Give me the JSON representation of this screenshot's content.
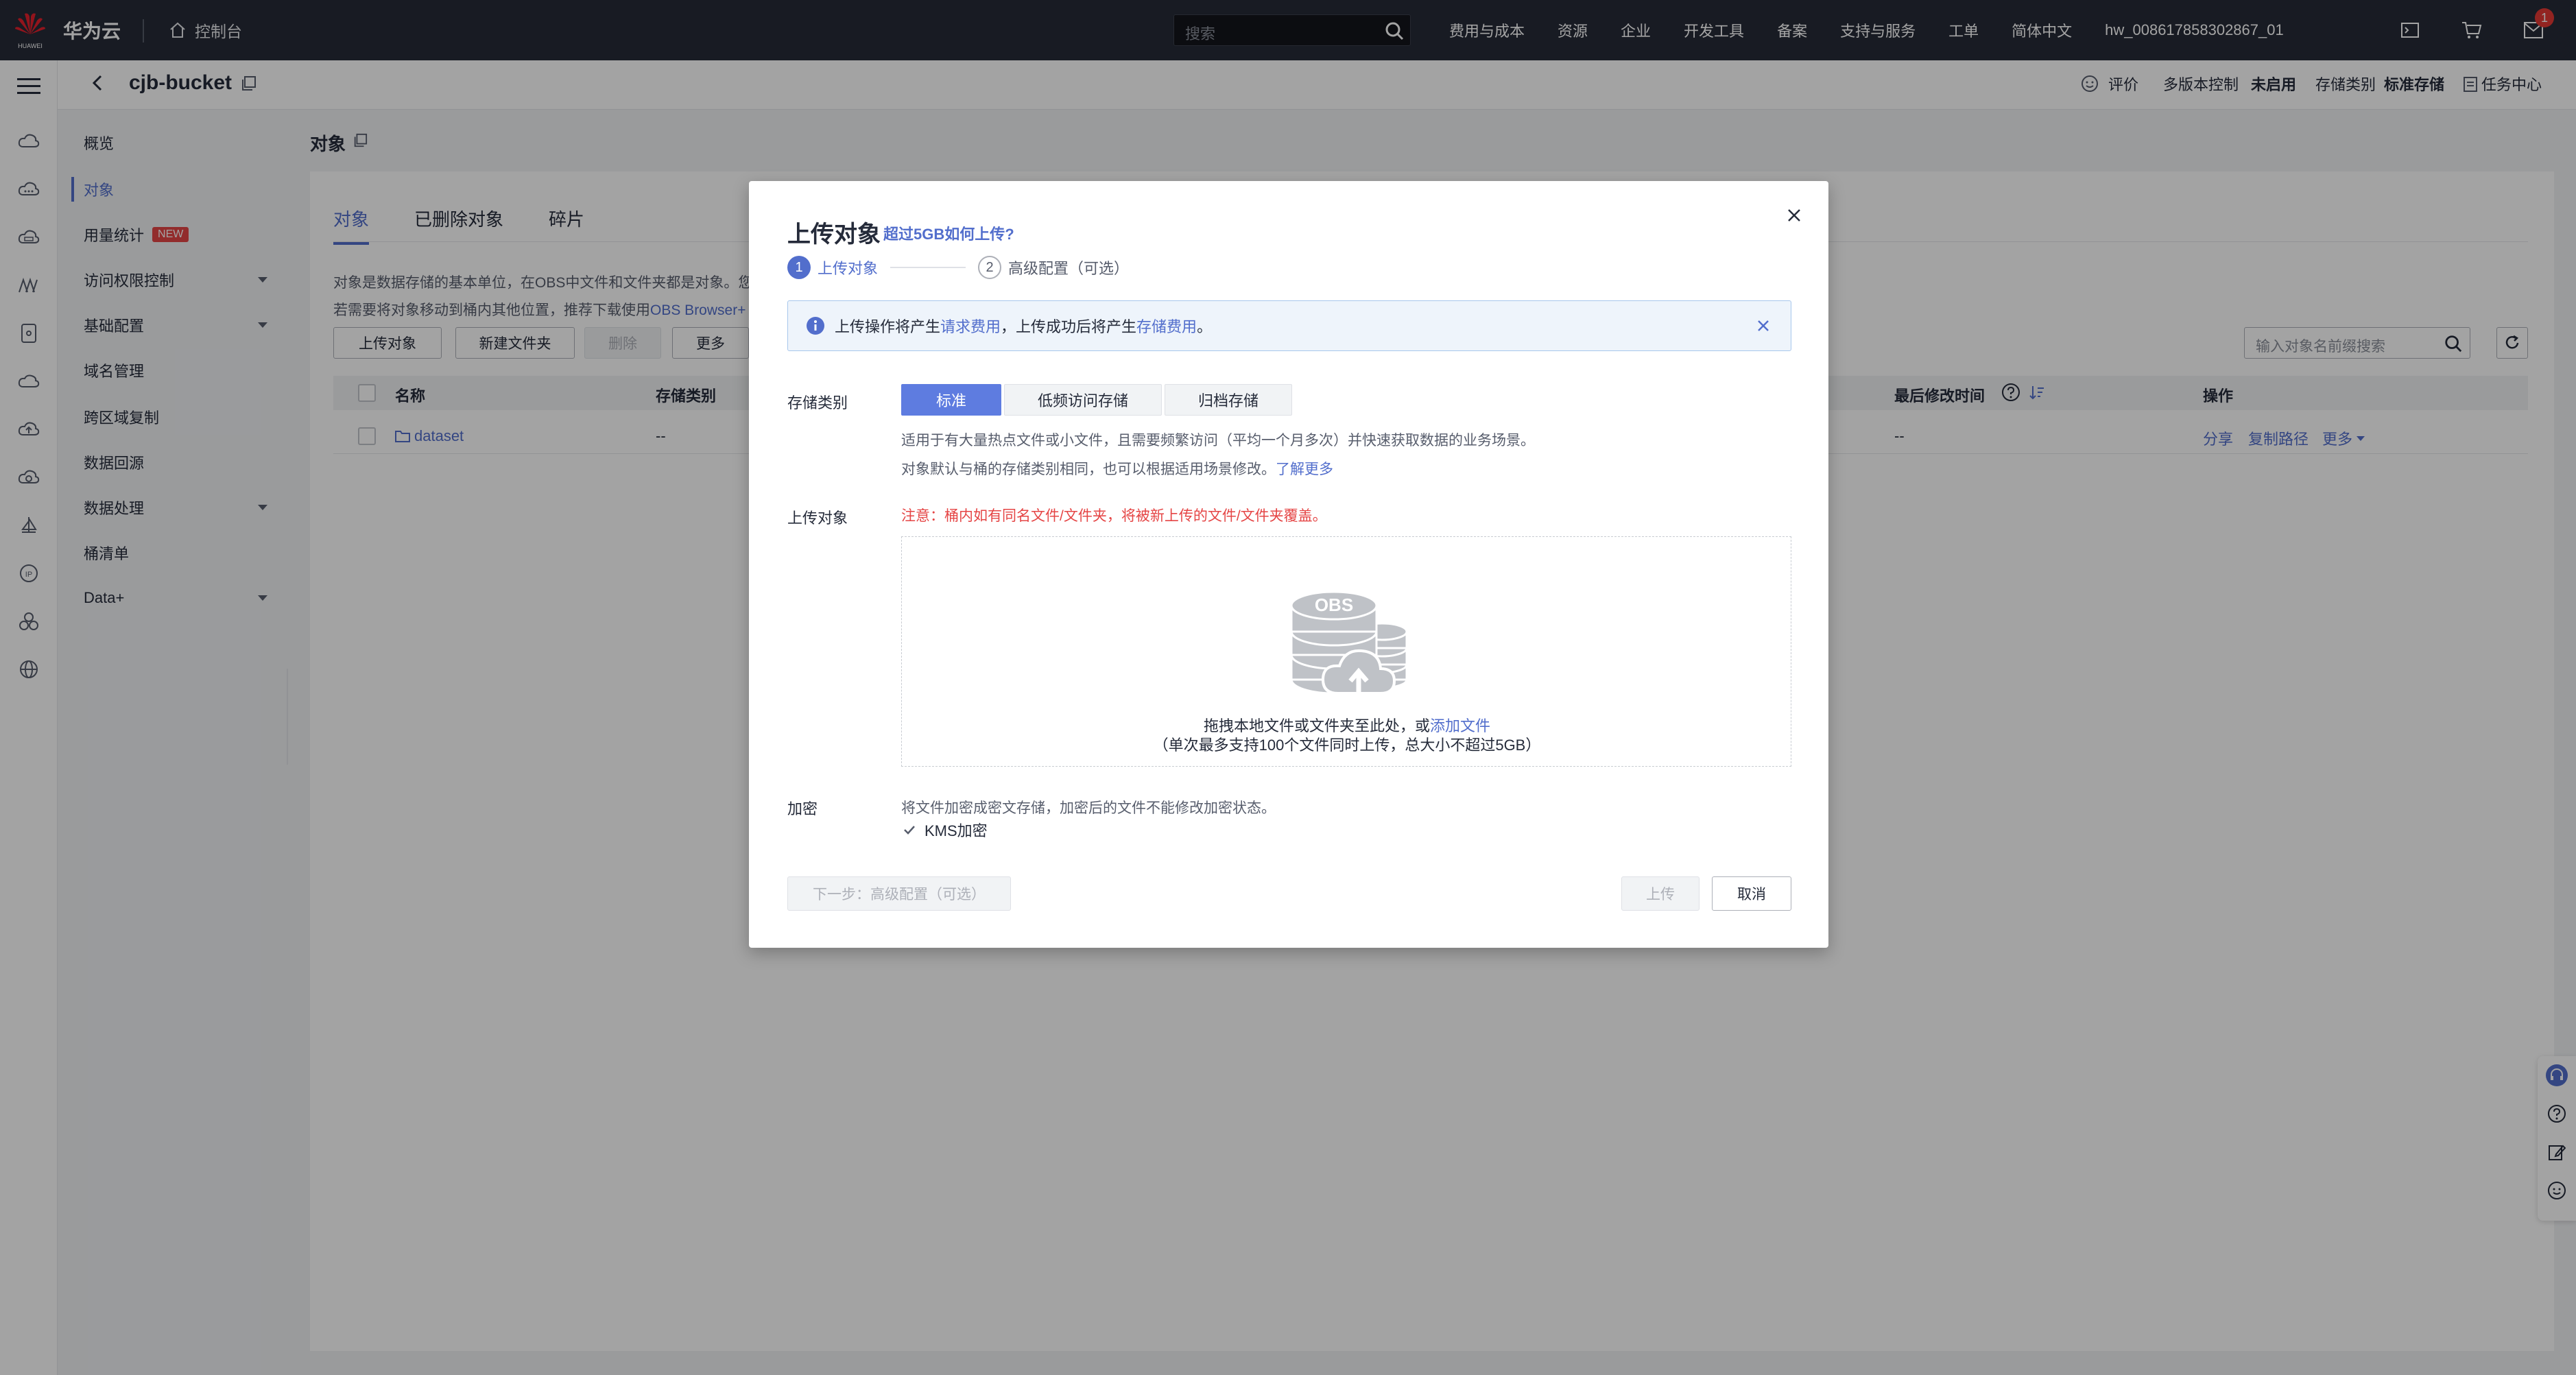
{
  "topbar": {
    "brand": "华为云",
    "brand_sub": "HUAWEI",
    "console": "控制台",
    "search_placeholder": "搜索",
    "links": [
      "费用与成本",
      "资源",
      "企业",
      "开发工具",
      "备案",
      "支持与服务",
      "工单",
      "简体中文",
      "hw_008617858302867_01"
    ],
    "message_count": "1"
  },
  "header": {
    "bucket_name": "cjb-bucket",
    "rate": "评价",
    "versioning_label": "多版本控制",
    "versioning_value": "未启用",
    "storage_class_label": "存储类别",
    "storage_class_value": "标准存储",
    "task_center": "任务中心"
  },
  "sidemenu": {
    "items": [
      {
        "label": "概览"
      },
      {
        "label": "对象"
      },
      {
        "label": "用量统计",
        "badge": "NEW"
      },
      {
        "label": "访问权限控制"
      },
      {
        "label": "基础配置"
      },
      {
        "label": "域名管理"
      },
      {
        "label": "跨区域复制"
      },
      {
        "label": "数据回源"
      },
      {
        "label": "数据处理"
      },
      {
        "label": "桶清单"
      },
      {
        "label": "Data+"
      }
    ]
  },
  "main": {
    "title": "对象",
    "tabs": [
      "对象",
      "已删除对象",
      "碎片"
    ],
    "desc1": "对象是数据存储的基本单位，在OBS中文件和文件夹都是对象。您",
    "desc2": "若需要将对象移动到桶内其他位置，推荐下载使用",
    "desc2_link": "OBS Browser+",
    "toolbar": {
      "upload": "上传对象",
      "new_folder": "新建文件夹",
      "delete": "删除",
      "more": "更多"
    },
    "search_placeholder": "输入对象名前缀搜索",
    "columns": {
      "name": "名称",
      "storage_class": "存储类别",
      "last_modified": "最后修改时间",
      "actions": "操作"
    },
    "rows": [
      {
        "name": "dataset",
        "storage_class": "--",
        "last_modified": "--",
        "share": "分享",
        "copy_path": "复制路径",
        "more": "更多"
      }
    ]
  },
  "modal": {
    "title": "上传对象",
    "title_link": "超过5GB如何上传?",
    "steps": [
      {
        "num": "1",
        "label": "上传对象"
      },
      {
        "num": "2",
        "label": "高级配置（可选）"
      }
    ],
    "notice_prefix": "上传操作将产生",
    "notice_link1": "请求费用",
    "notice_mid": "，上传成功后将产生",
    "notice_link2": "存储费用",
    "notice_suffix": "。",
    "storage_label": "存储类别",
    "storage_options": [
      "标准",
      "低频访问存储",
      "归档存储"
    ],
    "storage_hint1": "适用于有大量热点文件或小文件，且需要频繁访问（平均一个月多次）并快速获取数据的业务场景。",
    "storage_hint2": "对象默认与桶的存储类别相同，也可以根据适用场景修改。",
    "storage_hint2_link": "了解更多",
    "upload_label": "上传对象",
    "upload_warning": "注意：桶内如有同名文件/文件夹，将被新上传的文件/文件夹覆盖。",
    "obs_text": "OBS",
    "drop_text": "拖拽本地文件或文件夹至此处，或",
    "drop_link": "添加文件",
    "drop_sub": "（单次最多支持100个文件同时上传，总大小不超过5GB）",
    "encrypt_label": "加密",
    "encrypt_hint": "将文件加密成密文存储，加密后的文件不能修改加密状态。",
    "kms_label": "KMS加密",
    "next_btn": "下一步：高级配置（可选）",
    "upload_btn": "上传",
    "cancel_btn": "取消"
  },
  "colors": {
    "accent": "#526ecc",
    "topbar": "#262b37",
    "danger": "#e54545"
  }
}
